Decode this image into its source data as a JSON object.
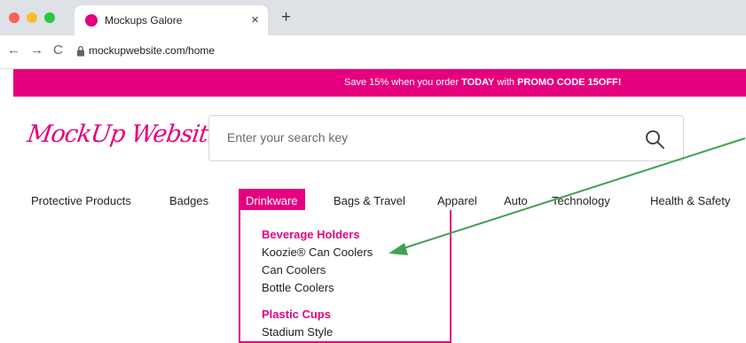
{
  "browser": {
    "tab_title": "Mockups Galore",
    "tab_close": "×",
    "new_tab": "+",
    "back": "←",
    "forward": "→",
    "reload": "C",
    "url": "mockupwebsite.com/home"
  },
  "promo": {
    "prefix": "Save 15% when you order ",
    "today": "TODAY",
    "middle": " with ",
    "code": "PROMO CODE 15OFF!"
  },
  "header": {
    "logo": "MockUp Website",
    "search_placeholder": "Enter your search key"
  },
  "nav": {
    "items": [
      "Protective Products",
      "Badges",
      "Drinkware",
      "Bags & Travel",
      "Apparel",
      "Auto",
      "Technology",
      "Health & Safety"
    ],
    "active": "Drinkware"
  },
  "dropdown": {
    "section1_title": "Beverage Holders",
    "section1_items": [
      "Koozie® Can Coolers",
      "Can Coolers",
      "Bottle Coolers"
    ],
    "section2_title": "Plastic Cups",
    "section2_items": [
      "Stadium Style"
    ]
  },
  "colors": {
    "brand_pink": "#e5007e",
    "arrow_green": "#3fa34d"
  }
}
